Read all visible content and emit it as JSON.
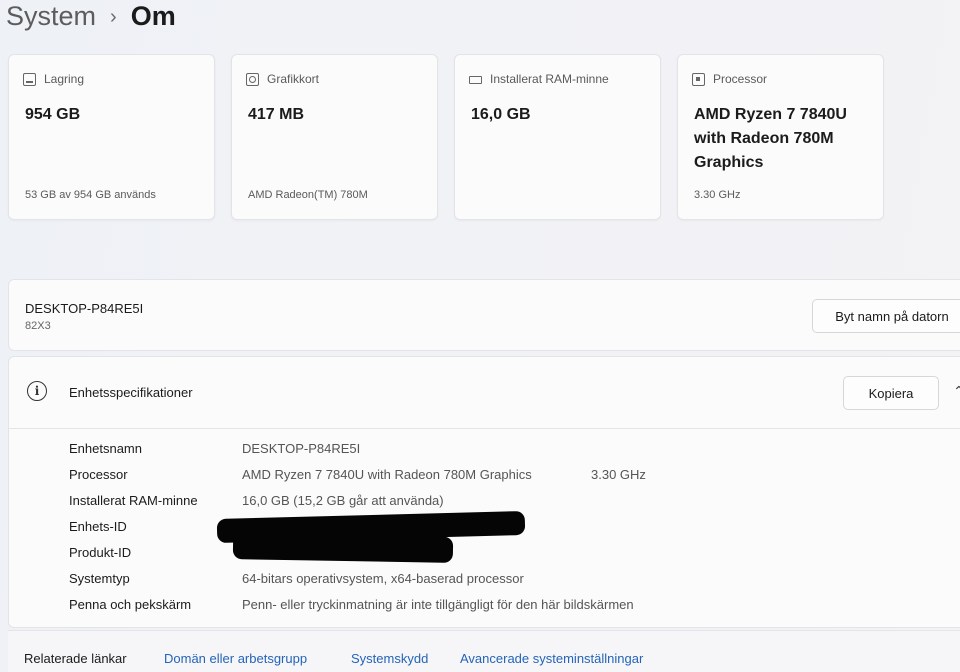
{
  "breadcrumb": {
    "parent": "System",
    "separator": "›",
    "current": "Om"
  },
  "cards": [
    {
      "icon": "storage-icon",
      "label": "Lagring",
      "value": "954 GB",
      "sub": "53 GB av 954 GB används"
    },
    {
      "icon": "gpu-icon",
      "label": "Grafikkort",
      "value": "417 MB",
      "sub": "AMD Radeon(TM) 780M"
    },
    {
      "icon": "ram-icon",
      "label": "Installerat RAM-minne",
      "value": "16,0 GB",
      "sub": ""
    },
    {
      "icon": "processor-icon",
      "label": "Processor",
      "value": "AMD Ryzen 7 7840U with Radeon 780M Graphics",
      "sub": "3.30 GHz"
    }
  ],
  "device": {
    "name": "DESKTOP-P84RE5I",
    "model": "82X3",
    "rename_label": "Byt namn på datorn"
  },
  "specs": {
    "title": "Enhetsspecifikationer",
    "copy_label": "Kopiera",
    "rows": [
      {
        "label": "Enhetsnamn",
        "value": "DESKTOP-P84RE5I",
        "extra": ""
      },
      {
        "label": "Processor",
        "value": "AMD Ryzen 7 7840U with Radeon 780M Graphics",
        "extra": "3.30 GHz"
      },
      {
        "label": "Installerat RAM-minne",
        "value": "16,0 GB (15,2 GB går att använda)",
        "extra": ""
      },
      {
        "label": "Enhets-ID",
        "value": "",
        "extra": ""
      },
      {
        "label": "Produkt-ID",
        "value": "",
        "extra": ""
      },
      {
        "label": "Systemtyp",
        "value": "64-bitars operativsystem, x64-baserad processor",
        "extra": ""
      },
      {
        "label": "Penna och pekskärm",
        "value": "Penn- eller tryckinmatning är inte tillgängligt för den här bildskärmen",
        "extra": ""
      }
    ]
  },
  "related": {
    "label": "Relaterade länkar",
    "links": [
      "Domän eller arbetsgrupp",
      "Systemskydd",
      "Avancerade systeminställningar"
    ]
  }
}
